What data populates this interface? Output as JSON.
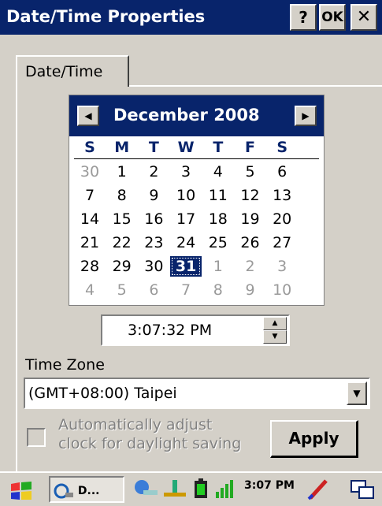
{
  "window": {
    "title": "Date/Time Properties",
    "help_label": "?",
    "ok_label": "OK",
    "close_label": "✕"
  },
  "tabs": [
    {
      "label": "Date/Time",
      "active": true
    }
  ],
  "calendar": {
    "month_year": "December 2008",
    "prev_icon": "◀",
    "next_icon": "▶",
    "weekdays": [
      "S",
      "M",
      "T",
      "W",
      "T",
      "F",
      "S"
    ],
    "weeks": [
      [
        "30",
        "1",
        "2",
        "3",
        "4",
        "5",
        "6"
      ],
      [
        "7",
        "8",
        "9",
        "10",
        "11",
        "12",
        "13"
      ],
      [
        "14",
        "15",
        "16",
        "17",
        "18",
        "19",
        "20"
      ],
      [
        "21",
        "22",
        "23",
        "24",
        "25",
        "26",
        "27"
      ],
      [
        "28",
        "29",
        "30",
        "31",
        "1",
        "2",
        "3"
      ],
      [
        "4",
        "5",
        "6",
        "7",
        "8",
        "9",
        "10"
      ]
    ],
    "selected": "31",
    "header_color": "#08246b"
  },
  "time": {
    "value": "3:07:32 PM",
    "up_icon": "▲",
    "down_icon": "▼"
  },
  "time_zone": {
    "label": "Time Zone",
    "value": "(GMT+08:00) Taipei",
    "dropdown_icon": "▼"
  },
  "daylight": {
    "label_line1": "Automatically adjust",
    "label_line2": "clock for daylight saving",
    "checked": false
  },
  "apply_label": "Apply",
  "taskbar": {
    "task_label": "D...",
    "clock": "3:07 PM"
  }
}
